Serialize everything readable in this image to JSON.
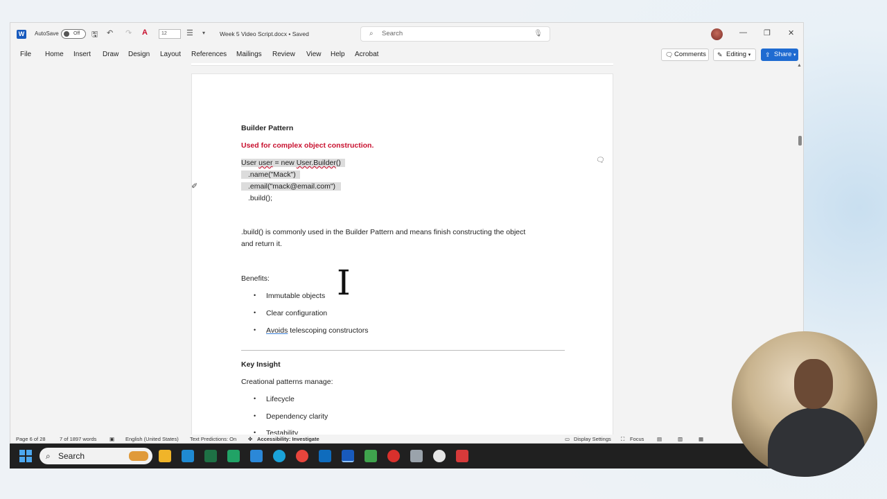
{
  "titlebar": {
    "autosave_label": "AutoSave",
    "autosave_state": "Off",
    "font_size": "12",
    "document_title": "Week 5 Video Script.docx • Saved",
    "search_placeholder": "Search"
  },
  "menu": {
    "items": [
      "File",
      "Home",
      "Insert",
      "Draw",
      "Design",
      "Layout",
      "References",
      "Mailings",
      "Review",
      "View",
      "Help",
      "Acrobat"
    ],
    "comments_label": "Comments",
    "editing_label": "Editing",
    "share_label": "Share"
  },
  "document": {
    "heading": "Builder Pattern",
    "subheading": "Used for complex object construction.",
    "code": {
      "line1_a": "User ",
      "line1_user": "user",
      "line1_b": " = new ",
      "line1_builder": "User.Builder",
      "line1_c": "()",
      "line2": ".name(\"Mack\")",
      "line3": ".email(\"mack@email.com\")",
      "line4": ".build();"
    },
    "paragraph_line1": ".build() is commonly used in the Builder Pattern and means finish constructing the object",
    "paragraph_line2": "and return it.",
    "benefits_label": "Benefits:",
    "benefits": [
      "Immutable objects",
      "Clear configuration"
    ],
    "benefit3_word": "Avoids",
    "benefit3_rest": " telescoping constructors",
    "key_insight_heading": "Key Insight",
    "creational_text": "Creational patterns manage:",
    "creational_items": [
      "Lifecycle",
      "Dependency clarity",
      "Testability"
    ]
  },
  "statusbar": {
    "page": "Page 6 of 28",
    "words": "7 of 1897 words",
    "language": "English (United States)",
    "predictions": "Text Predictions: On",
    "accessibility": "Accessibility: Investigate",
    "display_settings": "Display Settings",
    "focus": "Focus"
  },
  "taskbar": {
    "search_label": "Search"
  },
  "colors": {
    "accent": "#1f6bd1",
    "heading_red": "#c8102e",
    "word_blue": "#185abd"
  }
}
